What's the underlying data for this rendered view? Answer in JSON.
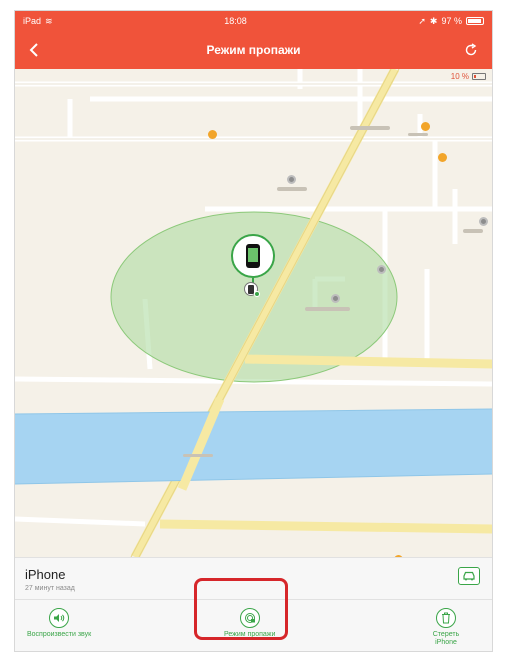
{
  "status": {
    "device": "iPad",
    "time": "18:08",
    "battery": "97 %"
  },
  "nav": {
    "title": "Режим пропажи"
  },
  "map": {
    "device_battery": "10 %"
  },
  "device": {
    "name": "iPhone",
    "last_seen": "27 минут назад"
  },
  "actions": {
    "play_sound": "Воспроизвести звук",
    "lost_mode": "Режим пропажи",
    "erase_line1": "Стереть",
    "erase_line2": "iPhone"
  },
  "colors": {
    "accent": "#f0533a",
    "green": "#3aa548",
    "highlight": "#d6262a"
  }
}
